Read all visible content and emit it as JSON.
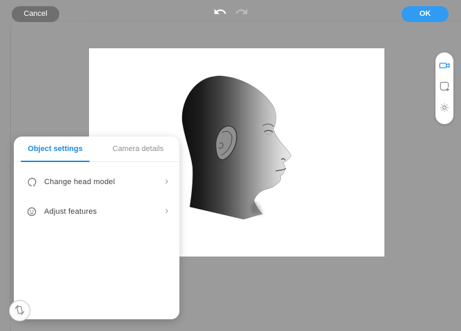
{
  "header": {
    "cancel_label": "Cancel",
    "ok_label": "OK",
    "undo_icon": "undo-arrow-icon",
    "redo_icon": "redo-arrow-icon",
    "redo_disabled": true
  },
  "toolbar": {
    "icons": [
      {
        "name": "video-camera-icon",
        "active": true
      },
      {
        "name": "transform-object-icon",
        "active": false
      },
      {
        "name": "brightness-icon",
        "active": false
      }
    ]
  },
  "panel": {
    "tabs": [
      {
        "label": "Object settings",
        "active": true
      },
      {
        "label": "Camera details",
        "active": false
      }
    ],
    "items": [
      {
        "icon": "head-outline-icon",
        "label": "Change head model",
        "chevron": "›"
      },
      {
        "icon": "face-features-icon",
        "label": "Adjust features",
        "chevron": "›"
      }
    ]
  },
  "floating": {
    "rotate_button_icon": "rotate-canvas-icon"
  },
  "canvas": {
    "content": "3D human head model, right-facing profile, grayscale render"
  },
  "colors": {
    "background": "#9a9a9a",
    "accent_blue": "#1e88e5",
    "ok_button": "#2f9bf3",
    "cancel_button": "#6f6f6f",
    "panel_bg": "#ffffff",
    "disabled_icon": "#bdbdbd"
  }
}
